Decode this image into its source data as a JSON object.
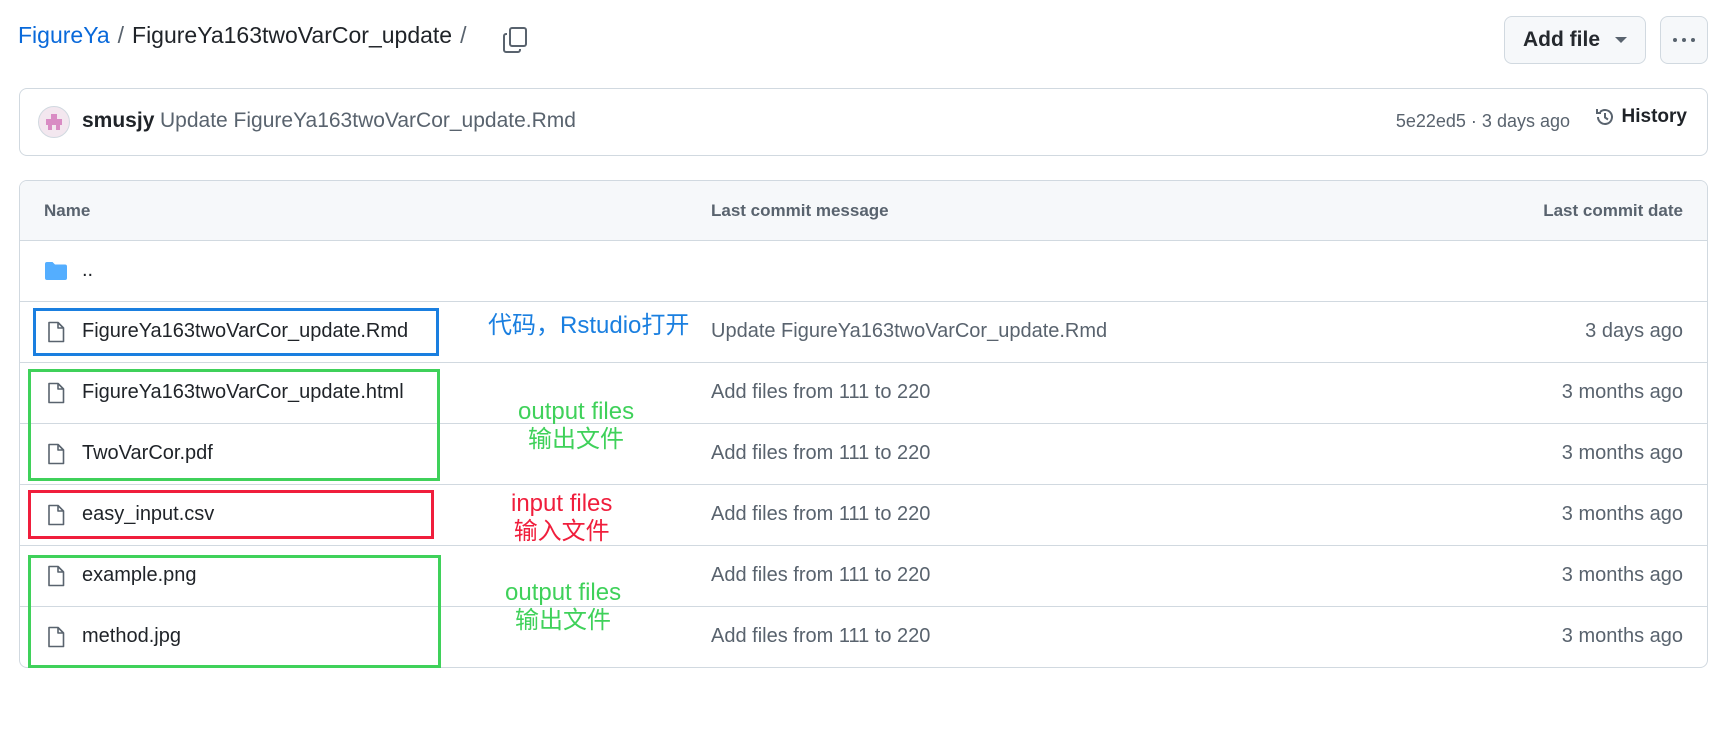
{
  "breadcrumb": {
    "repo": "FigureYa",
    "separator": "/",
    "folder": "FigureYa163twoVarCor_update",
    "trailing": "/"
  },
  "toolbar": {
    "add_file_label": "Add file"
  },
  "latest_commit": {
    "author": "smusjy",
    "message": "Update FigureYa163twoVarCor_update.Rmd",
    "meta": "5e22ed5 · 3 days ago",
    "history_label": "History"
  },
  "table": {
    "headers": {
      "name": "Name",
      "message": "Last commit message",
      "date": "Last commit date"
    },
    "parent_label": "..",
    "rows": [
      {
        "name": "FigureYa163twoVarCor_update.Rmd",
        "message": "Update FigureYa163twoVarCor_update.Rmd",
        "date": "3 days ago"
      },
      {
        "name": "FigureYa163twoVarCor_update.html",
        "message": "Add files from 111 to 220",
        "date": "3 months ago"
      },
      {
        "name": "TwoVarCor.pdf",
        "message": "Add files from 111 to 220",
        "date": "3 months ago"
      },
      {
        "name": "easy_input.csv",
        "message": "Add files from 111 to 220",
        "date": "3 months ago"
      },
      {
        "name": "example.png",
        "message": "Add files from 111 to 220",
        "date": "3 months ago"
      },
      {
        "name": "method.jpg",
        "message": "Add files from 111 to 220",
        "date": "3 months ago"
      }
    ]
  },
  "annotations": {
    "code": {
      "text": "代码，Rstudio打开",
      "color": "#1a7fe0"
    },
    "output1": {
      "line1": "output files",
      "line2": "输出文件",
      "color": "#3fd15a"
    },
    "input": {
      "line1": "input files",
      "line2": "输入文件",
      "color": "#f01e3c"
    },
    "output2": {
      "line1": "output files",
      "line2": "输出文件",
      "color": "#3fd15a"
    }
  },
  "colors": {
    "link": "#0969da",
    "muted": "#59636e",
    "border": "#d1d9e0",
    "folder": "#54aeff"
  }
}
